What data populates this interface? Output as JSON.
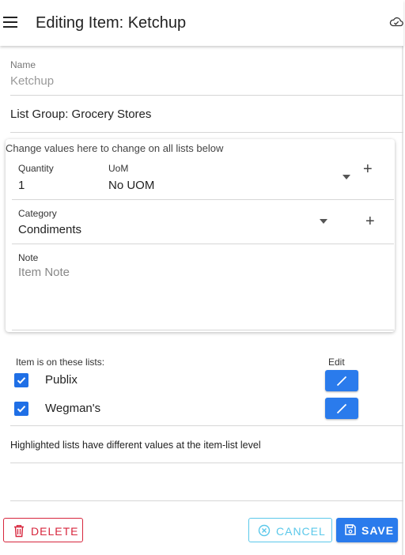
{
  "header": {
    "title": "Editing Item: Ketchup",
    "menu_icon": "hamburger-menu-icon",
    "sync_icon": "cloud-sync-icon"
  },
  "item": {
    "name_label": "Name",
    "name_value": "Ketchup",
    "list_group": "List Group: Grocery Stores"
  },
  "card": {
    "hint": "Change values here to change on all lists below",
    "quantity_label": "Quantity",
    "quantity_value": "1",
    "uom_label": "UoM",
    "uom_value": "No UOM",
    "category_label": "Category",
    "category_value": "Condiments",
    "note_label": "Note",
    "note_placeholder": "Item Note"
  },
  "lists": {
    "header_label": "Item is on these lists:",
    "edit_header": "Edit",
    "items": [
      {
        "name": "Publix",
        "checked": true
      },
      {
        "name": "Wegman's",
        "checked": true
      }
    ]
  },
  "highlight_note": "Highlighted lists have different values at the item-list level",
  "footer": {
    "delete_label": "DELETE",
    "cancel_label": "CANCEL",
    "save_label": "SAVE"
  },
  "colors": {
    "primary": "#2a7bec",
    "danger": "#d7263d",
    "cancel": "#5bc8ea",
    "checkbox": "#1f6fe6"
  }
}
